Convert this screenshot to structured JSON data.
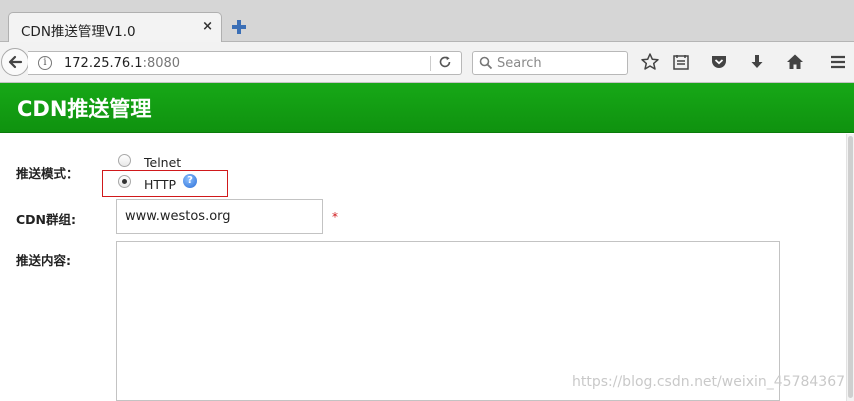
{
  "browser": {
    "tab_title": "CDN推送管理V1.0",
    "tab_close": "×",
    "url_host": "172.25.76.1",
    "url_port": ":8080",
    "search_placeholder": "Search"
  },
  "page": {
    "title": "CDN推送管理"
  },
  "form": {
    "mode_label": "推送模式：",
    "mode_options": [
      {
        "label": "Telnet",
        "checked": false
      },
      {
        "label": "HTTP",
        "checked": true
      }
    ],
    "help_glyph": "?",
    "group_label": "CDN群组:",
    "group_value": "www.westos.org",
    "required_mark": "*",
    "content_label": "推送内容:",
    "content_value": ""
  },
  "watermark": "https://blog.csdn.net/weixin_45784367",
  "colors": {
    "header_green": "#13a013",
    "highlight_red": "#d0191b",
    "required_red": "#d0191b"
  }
}
